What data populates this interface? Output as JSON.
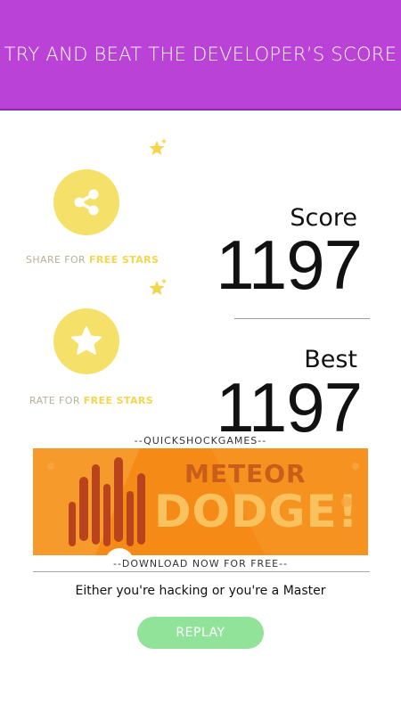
{
  "header": {
    "title": "TRY AND BEAT THE DEVELOPER’S SCORE"
  },
  "share": {
    "label_prefix": "SHARE FOR ",
    "label_highlight": "FREE STARS"
  },
  "rate": {
    "label_prefix": "RATE FOR ",
    "label_highlight": "FREE STARS"
  },
  "score": {
    "caption": "Score",
    "value": "1197"
  },
  "best": {
    "caption": "Best",
    "value": "1197"
  },
  "promo": {
    "studio_caption": "--QUICKSHOCKGAMES--",
    "banner_word1": "METEOR",
    "banner_word2": "DODGE!",
    "download_caption": "--DOWNLOAD NOW FOR FREE--"
  },
  "status_message": "Either you're hacking or you're a Master",
  "replay_label": "REPLAY",
  "colors": {
    "header": "#bb42d6",
    "circle": "#f5e16a",
    "star": "#f3d64d",
    "banner": "#f58a16",
    "replay": "#90e398"
  }
}
